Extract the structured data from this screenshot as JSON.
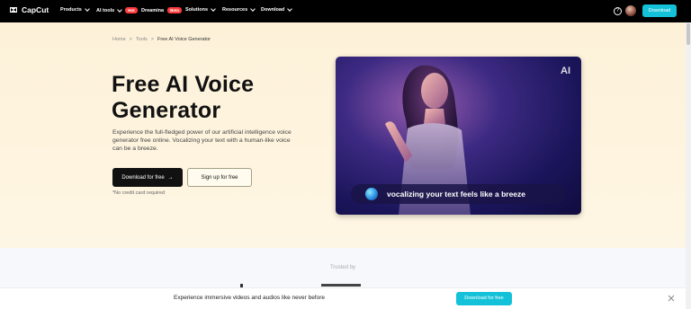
{
  "nav": {
    "brand": "CapCut",
    "items": [
      {
        "label": "Products",
        "badge": ""
      },
      {
        "label": "AI tools",
        "badge": "Hot"
      },
      {
        "label": "Dreamina",
        "badge": "Beta"
      },
      {
        "label": "Solutions",
        "badge": ""
      },
      {
        "label": "Resources",
        "badge": ""
      },
      {
        "label": "Download",
        "badge": ""
      }
    ],
    "help_icon": "?",
    "download_label": "Download"
  },
  "breadcrumb": {
    "items": [
      "Home",
      ">",
      "Tools",
      ">",
      "Free AI Voice Generator"
    ]
  },
  "hero": {
    "title_line1": "Free AI Voice",
    "title_line2": "Generator",
    "description": "Experience the full-fledged power of our artificial intelligence voice generator free online. Vocalizing your text with a human-like voice can be a breeze.",
    "primary_cta": "Download for free",
    "primary_arrow": "→",
    "secondary_cta": "Sign up for free",
    "note": "*No credit card required"
  },
  "media": {
    "ai_tag": "AI",
    "caption": "vocalizing your text feels like a breeze"
  },
  "trusted": {
    "label": "Trusted by"
  },
  "banner": {
    "text": "Experience immersive videos and audios like never before",
    "cta": "Download for free"
  },
  "colors": {
    "accent": "#13c2d8",
    "hot_badge": "#ff3b3b",
    "nav_bg": "#000000"
  }
}
